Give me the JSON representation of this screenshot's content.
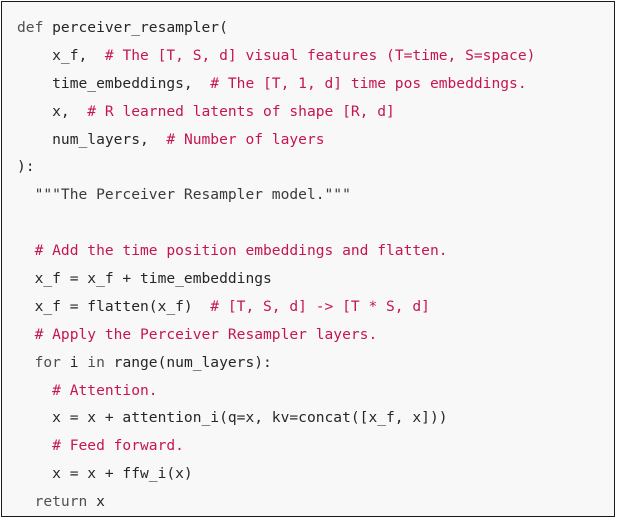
{
  "code": {
    "lines": [
      [
        {
          "kind": "kw",
          "text": "def"
        },
        {
          "kind": "plain",
          "text": " perceiver_resampler("
        }
      ],
      [
        {
          "kind": "plain",
          "text": "    x_f,  "
        },
        {
          "kind": "comment",
          "text": "# The [T, S, d] visual features (T=time, S=space)"
        }
      ],
      [
        {
          "kind": "plain",
          "text": "    time_embeddings,  "
        },
        {
          "kind": "comment",
          "text": "# The [T, 1, d] time pos embeddings."
        }
      ],
      [
        {
          "kind": "plain",
          "text": "    x,  "
        },
        {
          "kind": "comment",
          "text": "# R learned latents of shape [R, d]"
        }
      ],
      [
        {
          "kind": "plain",
          "text": "    num_layers,  "
        },
        {
          "kind": "comment",
          "text": "# Number of layers"
        }
      ],
      [
        {
          "kind": "plain",
          "text": "):"
        }
      ],
      [
        {
          "kind": "string",
          "text": "  \"\"\"The Perceiver Resampler model.\"\"\""
        }
      ],
      [
        {
          "kind": "plain",
          "text": ""
        }
      ],
      [
        {
          "kind": "comment",
          "text": "  # Add the time position embeddings and flatten."
        }
      ],
      [
        {
          "kind": "plain",
          "text": "  x_f = x_f + time_embeddings"
        }
      ],
      [
        {
          "kind": "plain",
          "text": "  x_f = flatten(x_f)  "
        },
        {
          "kind": "comment",
          "text": "# [T, S, d] -> [T * S, d]"
        }
      ],
      [
        {
          "kind": "comment",
          "text": "  # Apply the Perceiver Resampler layers."
        }
      ],
      [
        {
          "kind": "plain",
          "text": "  "
        },
        {
          "kind": "kw",
          "text": "for"
        },
        {
          "kind": "plain",
          "text": " i "
        },
        {
          "kind": "kw",
          "text": "in"
        },
        {
          "kind": "plain",
          "text": " range(num_layers):"
        }
      ],
      [
        {
          "kind": "comment",
          "text": "    # Attention."
        }
      ],
      [
        {
          "kind": "plain",
          "text": "    x = x + attention_i(q=x, kv=concat([x_f, x]))"
        }
      ],
      [
        {
          "kind": "comment",
          "text": "    # Feed forward."
        }
      ],
      [
        {
          "kind": "plain",
          "text": "    x = x + ffw_i(x)"
        }
      ],
      [
        {
          "kind": "plain",
          "text": "  "
        },
        {
          "kind": "kw",
          "text": "return"
        },
        {
          "kind": "plain",
          "text": " x"
        }
      ]
    ]
  },
  "colors": {
    "background": "#f8f8f8",
    "border": "#1a1a1a",
    "text": "#262626",
    "keyword": "#505050",
    "comment": "#c5164f"
  }
}
